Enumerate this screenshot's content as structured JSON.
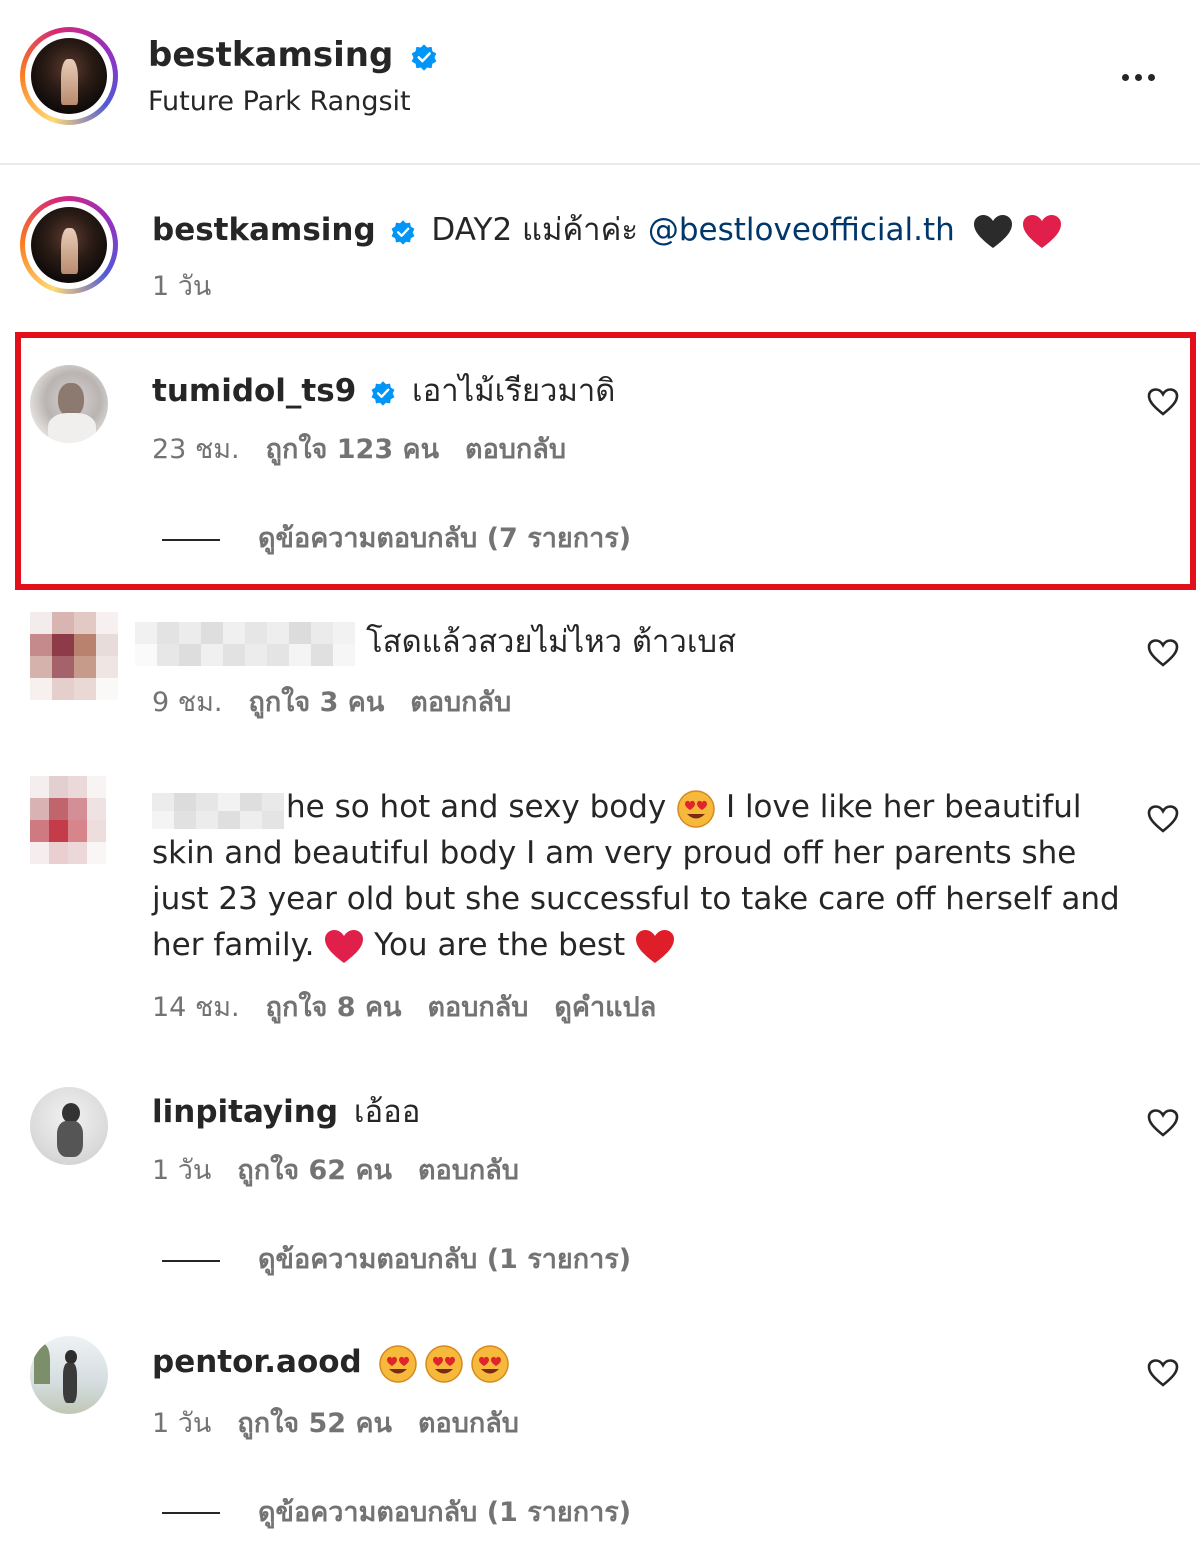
{
  "header": {
    "username": "bestkamsing",
    "location": "Future Park Rangsit"
  },
  "caption": {
    "username": "bestkamsing",
    "text": "DAY2 แม่ค้าค่ะ ",
    "mention": "@bestloveofficial.th",
    "time": "1 วัน"
  },
  "comments": [
    {
      "username": "tumidol_ts9",
      "text": "เอาไม้เรียวมาดิ",
      "time": "23 ชม.",
      "likes": "ถูกใจ 123 คน",
      "reply": "ตอบกลับ",
      "view_replies": "ดูข้อความตอบกลับ (7 รายการ)"
    },
    {
      "username": "",
      "text": "โสดแล้วสวยไม่ไหว ต้าวเบส",
      "time": "9 ชม.",
      "likes": "ถูกใจ 3 คน",
      "reply": "ตอบกลับ"
    },
    {
      "username": "",
      "text_line1": "he so hot and sexy body ",
      "text_line1b": " I love like her beautiful",
      "text_line2": "skin and beautiful body I am very proud off her parents she",
      "text_line3": "just 23 year old but she successful to take care off herself and",
      "text_line4a": "her family. ",
      "text_line4b": " You are the best ",
      "time": "14 ชม.",
      "likes": "ถูกใจ 8 คน",
      "reply": "ตอบกลับ",
      "translate": "ดูคำแปล"
    },
    {
      "username": "linpitaying",
      "text": "เอ้ออ",
      "time": "1 วัน",
      "likes": "ถูกใจ 62 คน",
      "reply": "ตอบกลับ",
      "view_replies": "ดูข้อความตอบกลับ (1 รายการ)"
    },
    {
      "username": "pentor.aood",
      "text": "",
      "time": "1 วัน",
      "likes": "ถูกใจ 52 คน",
      "reply": "ตอบกลับ",
      "view_replies": "ดูข้อความตอบกลับ (1 รายการ)"
    }
  ],
  "colors": {
    "verified": "#0095f6",
    "highlight": "#e3101c",
    "muted": "#737373",
    "link": "#00376b"
  },
  "icons": [
    "verified-badge-icon",
    "more-options-icon",
    "heart-icon",
    "black-heart-icon",
    "red-heart-icon",
    "heart-eyes-emoji"
  ]
}
